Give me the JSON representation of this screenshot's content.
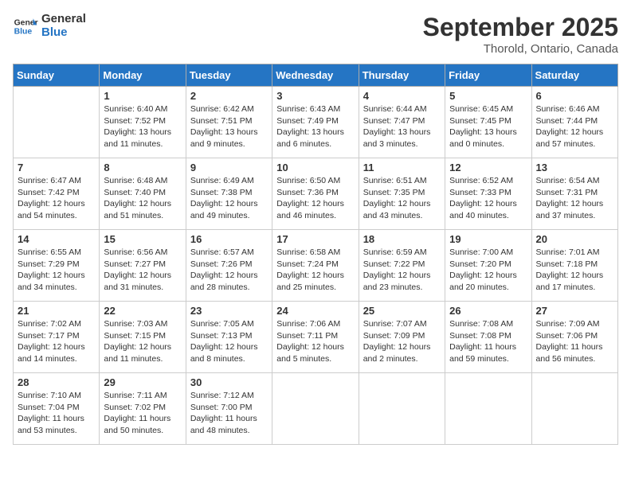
{
  "header": {
    "logo_line1": "General",
    "logo_line2": "Blue",
    "month": "September 2025",
    "location": "Thorold, Ontario, Canada"
  },
  "days_of_week": [
    "Sunday",
    "Monday",
    "Tuesday",
    "Wednesday",
    "Thursday",
    "Friday",
    "Saturday"
  ],
  "weeks": [
    [
      {
        "day": "",
        "info": ""
      },
      {
        "day": "1",
        "info": "Sunrise: 6:40 AM\nSunset: 7:52 PM\nDaylight: 13 hours\nand 11 minutes."
      },
      {
        "day": "2",
        "info": "Sunrise: 6:42 AM\nSunset: 7:51 PM\nDaylight: 13 hours\nand 9 minutes."
      },
      {
        "day": "3",
        "info": "Sunrise: 6:43 AM\nSunset: 7:49 PM\nDaylight: 13 hours\nand 6 minutes."
      },
      {
        "day": "4",
        "info": "Sunrise: 6:44 AM\nSunset: 7:47 PM\nDaylight: 13 hours\nand 3 minutes."
      },
      {
        "day": "5",
        "info": "Sunrise: 6:45 AM\nSunset: 7:45 PM\nDaylight: 13 hours\nand 0 minutes."
      },
      {
        "day": "6",
        "info": "Sunrise: 6:46 AM\nSunset: 7:44 PM\nDaylight: 12 hours\nand 57 minutes."
      }
    ],
    [
      {
        "day": "7",
        "info": "Sunrise: 6:47 AM\nSunset: 7:42 PM\nDaylight: 12 hours\nand 54 minutes."
      },
      {
        "day": "8",
        "info": "Sunrise: 6:48 AM\nSunset: 7:40 PM\nDaylight: 12 hours\nand 51 minutes."
      },
      {
        "day": "9",
        "info": "Sunrise: 6:49 AM\nSunset: 7:38 PM\nDaylight: 12 hours\nand 49 minutes."
      },
      {
        "day": "10",
        "info": "Sunrise: 6:50 AM\nSunset: 7:36 PM\nDaylight: 12 hours\nand 46 minutes."
      },
      {
        "day": "11",
        "info": "Sunrise: 6:51 AM\nSunset: 7:35 PM\nDaylight: 12 hours\nand 43 minutes."
      },
      {
        "day": "12",
        "info": "Sunrise: 6:52 AM\nSunset: 7:33 PM\nDaylight: 12 hours\nand 40 minutes."
      },
      {
        "day": "13",
        "info": "Sunrise: 6:54 AM\nSunset: 7:31 PM\nDaylight: 12 hours\nand 37 minutes."
      }
    ],
    [
      {
        "day": "14",
        "info": "Sunrise: 6:55 AM\nSunset: 7:29 PM\nDaylight: 12 hours\nand 34 minutes."
      },
      {
        "day": "15",
        "info": "Sunrise: 6:56 AM\nSunset: 7:27 PM\nDaylight: 12 hours\nand 31 minutes."
      },
      {
        "day": "16",
        "info": "Sunrise: 6:57 AM\nSunset: 7:26 PM\nDaylight: 12 hours\nand 28 minutes."
      },
      {
        "day": "17",
        "info": "Sunrise: 6:58 AM\nSunset: 7:24 PM\nDaylight: 12 hours\nand 25 minutes."
      },
      {
        "day": "18",
        "info": "Sunrise: 6:59 AM\nSunset: 7:22 PM\nDaylight: 12 hours\nand 23 minutes."
      },
      {
        "day": "19",
        "info": "Sunrise: 7:00 AM\nSunset: 7:20 PM\nDaylight: 12 hours\nand 20 minutes."
      },
      {
        "day": "20",
        "info": "Sunrise: 7:01 AM\nSunset: 7:18 PM\nDaylight: 12 hours\nand 17 minutes."
      }
    ],
    [
      {
        "day": "21",
        "info": "Sunrise: 7:02 AM\nSunset: 7:17 PM\nDaylight: 12 hours\nand 14 minutes."
      },
      {
        "day": "22",
        "info": "Sunrise: 7:03 AM\nSunset: 7:15 PM\nDaylight: 12 hours\nand 11 minutes."
      },
      {
        "day": "23",
        "info": "Sunrise: 7:05 AM\nSunset: 7:13 PM\nDaylight: 12 hours\nand 8 minutes."
      },
      {
        "day": "24",
        "info": "Sunrise: 7:06 AM\nSunset: 7:11 PM\nDaylight: 12 hours\nand 5 minutes."
      },
      {
        "day": "25",
        "info": "Sunrise: 7:07 AM\nSunset: 7:09 PM\nDaylight: 12 hours\nand 2 minutes."
      },
      {
        "day": "26",
        "info": "Sunrise: 7:08 AM\nSunset: 7:08 PM\nDaylight: 11 hours\nand 59 minutes."
      },
      {
        "day": "27",
        "info": "Sunrise: 7:09 AM\nSunset: 7:06 PM\nDaylight: 11 hours\nand 56 minutes."
      }
    ],
    [
      {
        "day": "28",
        "info": "Sunrise: 7:10 AM\nSunset: 7:04 PM\nDaylight: 11 hours\nand 53 minutes."
      },
      {
        "day": "29",
        "info": "Sunrise: 7:11 AM\nSunset: 7:02 PM\nDaylight: 11 hours\nand 50 minutes."
      },
      {
        "day": "30",
        "info": "Sunrise: 7:12 AM\nSunset: 7:00 PM\nDaylight: 11 hours\nand 48 minutes."
      },
      {
        "day": "",
        "info": ""
      },
      {
        "day": "",
        "info": ""
      },
      {
        "day": "",
        "info": ""
      },
      {
        "day": "",
        "info": ""
      }
    ]
  ]
}
